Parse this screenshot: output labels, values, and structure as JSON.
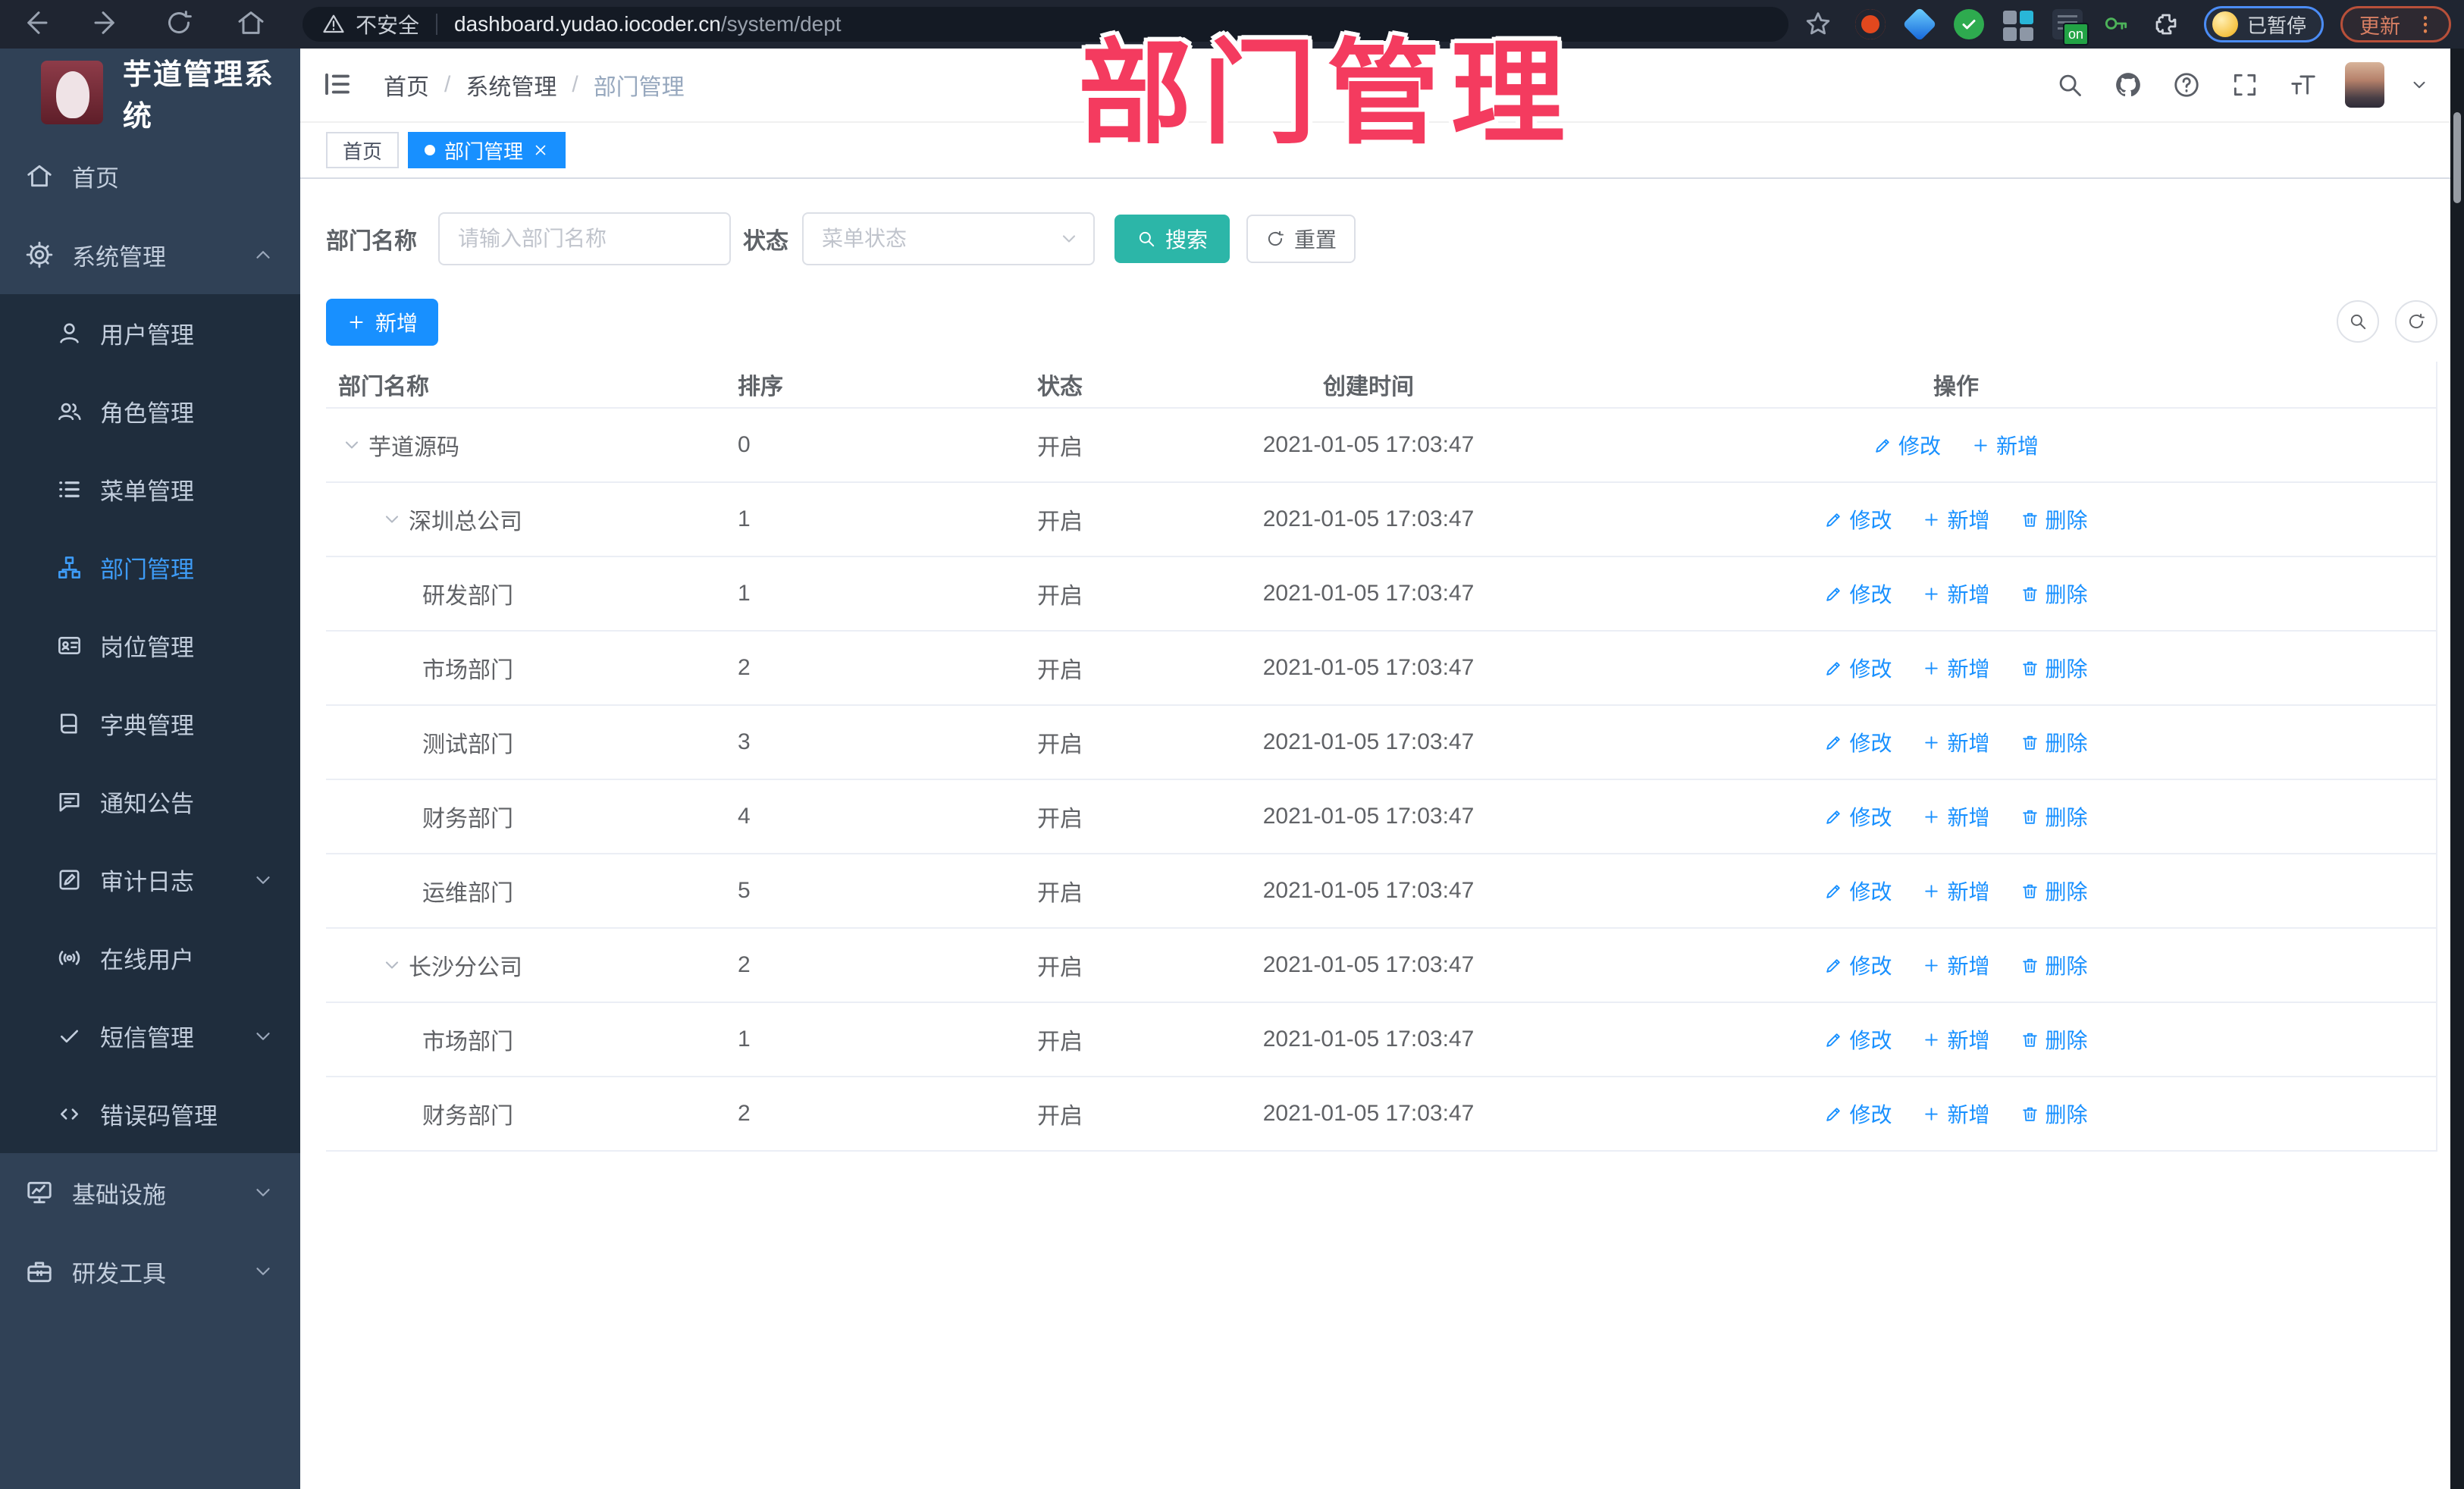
{
  "browser": {
    "security_text": "不安全",
    "url_domain": "dashboard.yudao.iocoder.cn",
    "url_path": "/system/dept",
    "extension_badge": "on",
    "profile_status": "已暂停",
    "update_label": "更新"
  },
  "watermark": {
    "text": "部门管理",
    "color": "#f43b5f"
  },
  "sidebar": {
    "logo_title": "芋道管理系统",
    "items": [
      {
        "label": "首页",
        "icon": "home-icon",
        "level": "top",
        "active": false,
        "chevron": null
      },
      {
        "label": "系统管理",
        "icon": "gear-icon",
        "level": "top",
        "active": false,
        "chevron": "up"
      },
      {
        "label": "用户管理",
        "icon": "user-icon",
        "level": "sub",
        "active": false,
        "chevron": null
      },
      {
        "label": "角色管理",
        "icon": "users-icon",
        "level": "sub",
        "active": false,
        "chevron": null
      },
      {
        "label": "菜单管理",
        "icon": "list-icon",
        "level": "sub",
        "active": false,
        "chevron": null
      },
      {
        "label": "部门管理",
        "icon": "tree-icon",
        "level": "sub",
        "active": true,
        "chevron": null
      },
      {
        "label": "岗位管理",
        "icon": "idcard-icon",
        "level": "sub",
        "active": false,
        "chevron": null
      },
      {
        "label": "字典管理",
        "icon": "book-icon",
        "level": "sub",
        "active": false,
        "chevron": null
      },
      {
        "label": "通知公告",
        "icon": "chat-icon",
        "level": "sub",
        "active": false,
        "chevron": null
      },
      {
        "label": "审计日志",
        "icon": "editlog-icon",
        "level": "sub",
        "active": false,
        "chevron": "down"
      },
      {
        "label": "在线用户",
        "icon": "online-icon",
        "level": "sub",
        "active": false,
        "chevron": null
      },
      {
        "label": "短信管理",
        "icon": "check-icon",
        "level": "sub",
        "active": false,
        "chevron": "down"
      },
      {
        "label": "错误码管理",
        "icon": "code-icon",
        "level": "sub",
        "active": false,
        "chevron": null
      },
      {
        "label": "基础设施",
        "icon": "monitor-icon",
        "level": "top",
        "active": false,
        "chevron": "down"
      },
      {
        "label": "研发工具",
        "icon": "toolbox-icon",
        "level": "top",
        "active": false,
        "chevron": "down"
      }
    ]
  },
  "header": {
    "breadcrumb": [
      "首页",
      "系统管理",
      "部门管理"
    ]
  },
  "tabs": [
    {
      "label": "首页",
      "active": false,
      "closable": false
    },
    {
      "label": "部门管理",
      "active": true,
      "closable": true
    }
  ],
  "filters": {
    "name_label": "部门名称",
    "name_placeholder": "请输入部门名称",
    "status_label": "状态",
    "status_placeholder": "菜单状态",
    "search_label": "搜索",
    "reset_label": "重置"
  },
  "toolbar": {
    "add_label": "新增"
  },
  "table": {
    "columns": [
      "部门名称",
      "排序",
      "状态",
      "创建时间",
      "操作"
    ],
    "rows": [
      {
        "name": "芋道源码",
        "level": 0,
        "expandable": true,
        "sort": "0",
        "status": "开启",
        "created": "2021-01-05 17:03:47",
        "actions": [
          {
            "icon": "pencil-icon",
            "label": "修改"
          },
          {
            "icon": "plus-icon",
            "label": "新增"
          }
        ]
      },
      {
        "name": "深圳总公司",
        "level": 1,
        "expandable": true,
        "sort": "1",
        "status": "开启",
        "created": "2021-01-05 17:03:47",
        "actions": [
          {
            "icon": "pencil-icon",
            "label": "修改"
          },
          {
            "icon": "plus-icon",
            "label": "新增"
          },
          {
            "icon": "trash-icon",
            "label": "删除"
          }
        ]
      },
      {
        "name": "研发部门",
        "level": 2,
        "expandable": false,
        "sort": "1",
        "status": "开启",
        "created": "2021-01-05 17:03:47",
        "actions": [
          {
            "icon": "pencil-icon",
            "label": "修改"
          },
          {
            "icon": "plus-icon",
            "label": "新增"
          },
          {
            "icon": "trash-icon",
            "label": "删除"
          }
        ]
      },
      {
        "name": "市场部门",
        "level": 2,
        "expandable": false,
        "sort": "2",
        "status": "开启",
        "created": "2021-01-05 17:03:47",
        "actions": [
          {
            "icon": "pencil-icon",
            "label": "修改"
          },
          {
            "icon": "plus-icon",
            "label": "新增"
          },
          {
            "icon": "trash-icon",
            "label": "删除"
          }
        ]
      },
      {
        "name": "测试部门",
        "level": 2,
        "expandable": false,
        "sort": "3",
        "status": "开启",
        "created": "2021-01-05 17:03:47",
        "actions": [
          {
            "icon": "pencil-icon",
            "label": "修改"
          },
          {
            "icon": "plus-icon",
            "label": "新增"
          },
          {
            "icon": "trash-icon",
            "label": "删除"
          }
        ]
      },
      {
        "name": "财务部门",
        "level": 2,
        "expandable": false,
        "sort": "4",
        "status": "开启",
        "created": "2021-01-05 17:03:47",
        "actions": [
          {
            "icon": "pencil-icon",
            "label": "修改"
          },
          {
            "icon": "plus-icon",
            "label": "新增"
          },
          {
            "icon": "trash-icon",
            "label": "删除"
          }
        ]
      },
      {
        "name": "运维部门",
        "level": 2,
        "expandable": false,
        "sort": "5",
        "status": "开启",
        "created": "2021-01-05 17:03:47",
        "actions": [
          {
            "icon": "pencil-icon",
            "label": "修改"
          },
          {
            "icon": "plus-icon",
            "label": "新增"
          },
          {
            "icon": "trash-icon",
            "label": "删除"
          }
        ]
      },
      {
        "name": "长沙分公司",
        "level": 1,
        "expandable": true,
        "sort": "2",
        "status": "开启",
        "created": "2021-01-05 17:03:47",
        "actions": [
          {
            "icon": "pencil-icon",
            "label": "修改"
          },
          {
            "icon": "plus-icon",
            "label": "新增"
          },
          {
            "icon": "trash-icon",
            "label": "删除"
          }
        ]
      },
      {
        "name": "市场部门",
        "level": 2,
        "expandable": false,
        "sort": "1",
        "status": "开启",
        "created": "2021-01-05 17:03:47",
        "actions": [
          {
            "icon": "pencil-icon",
            "label": "修改"
          },
          {
            "icon": "plus-icon",
            "label": "新增"
          },
          {
            "icon": "trash-icon",
            "label": "删除"
          }
        ]
      },
      {
        "name": "财务部门",
        "level": 2,
        "expandable": false,
        "sort": "2",
        "status": "开启",
        "created": "2021-01-05 17:03:47",
        "actions": [
          {
            "icon": "pencil-icon",
            "label": "修改"
          },
          {
            "icon": "plus-icon",
            "label": "新增"
          },
          {
            "icon": "trash-icon",
            "label": "删除"
          }
        ]
      }
    ]
  },
  "colors": {
    "accent_blue": "#1890ff",
    "search_teal": "#2cb6a8",
    "sidebar_bg": "#304156",
    "sidebar_sub_bg": "#1f2d3d",
    "active_link": "#3e9cf7",
    "watermark_pink": "#f43b5f"
  }
}
